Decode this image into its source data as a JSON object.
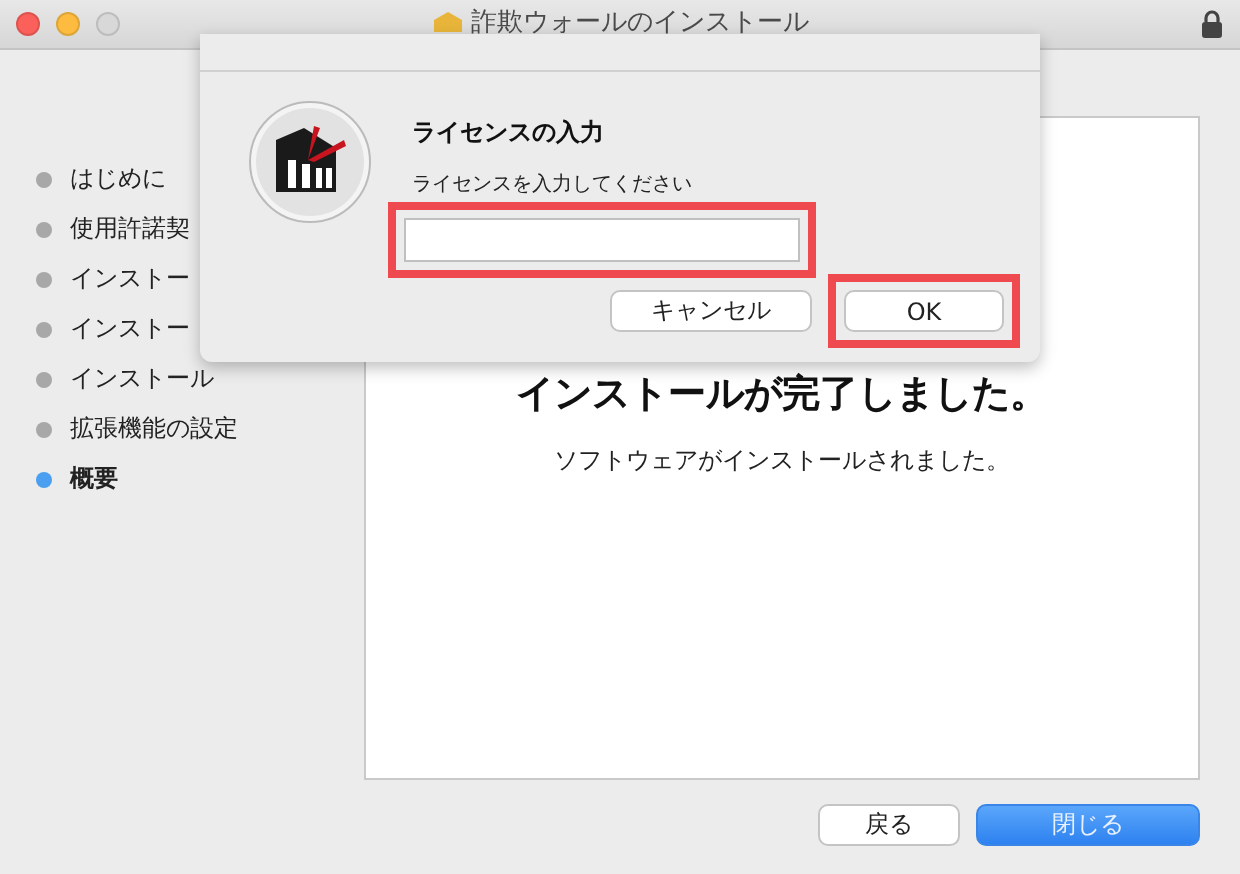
{
  "window": {
    "title": "詐欺ウォールのインストール"
  },
  "sidebar": {
    "steps": [
      {
        "label": "はじめに",
        "selected": false
      },
      {
        "label": "使用許諾契",
        "selected": false
      },
      {
        "label": "インストー",
        "selected": false
      },
      {
        "label": "インストー",
        "selected": false
      },
      {
        "label": "インストール",
        "selected": false
      },
      {
        "label": "拡張機能の設定",
        "selected": false
      },
      {
        "label": "概要",
        "selected": true
      }
    ]
  },
  "content": {
    "heading": "インストールが完了しました。",
    "message": "ソフトウェアがインストールされました。"
  },
  "buttons": [
    {
      "label": "戻る",
      "primary": false
    },
    {
      "label": "閉じる",
      "primary": true
    }
  ],
  "dialog": {
    "title": "ライセンスの入力",
    "prompt": "ライセンスを入力してください",
    "input": {
      "highlighted": true
    },
    "buttons": [
      {
        "label": "キャンセル",
        "highlighted": false
      },
      {
        "label": "OK",
        "highlighted": true
      }
    ]
  }
}
